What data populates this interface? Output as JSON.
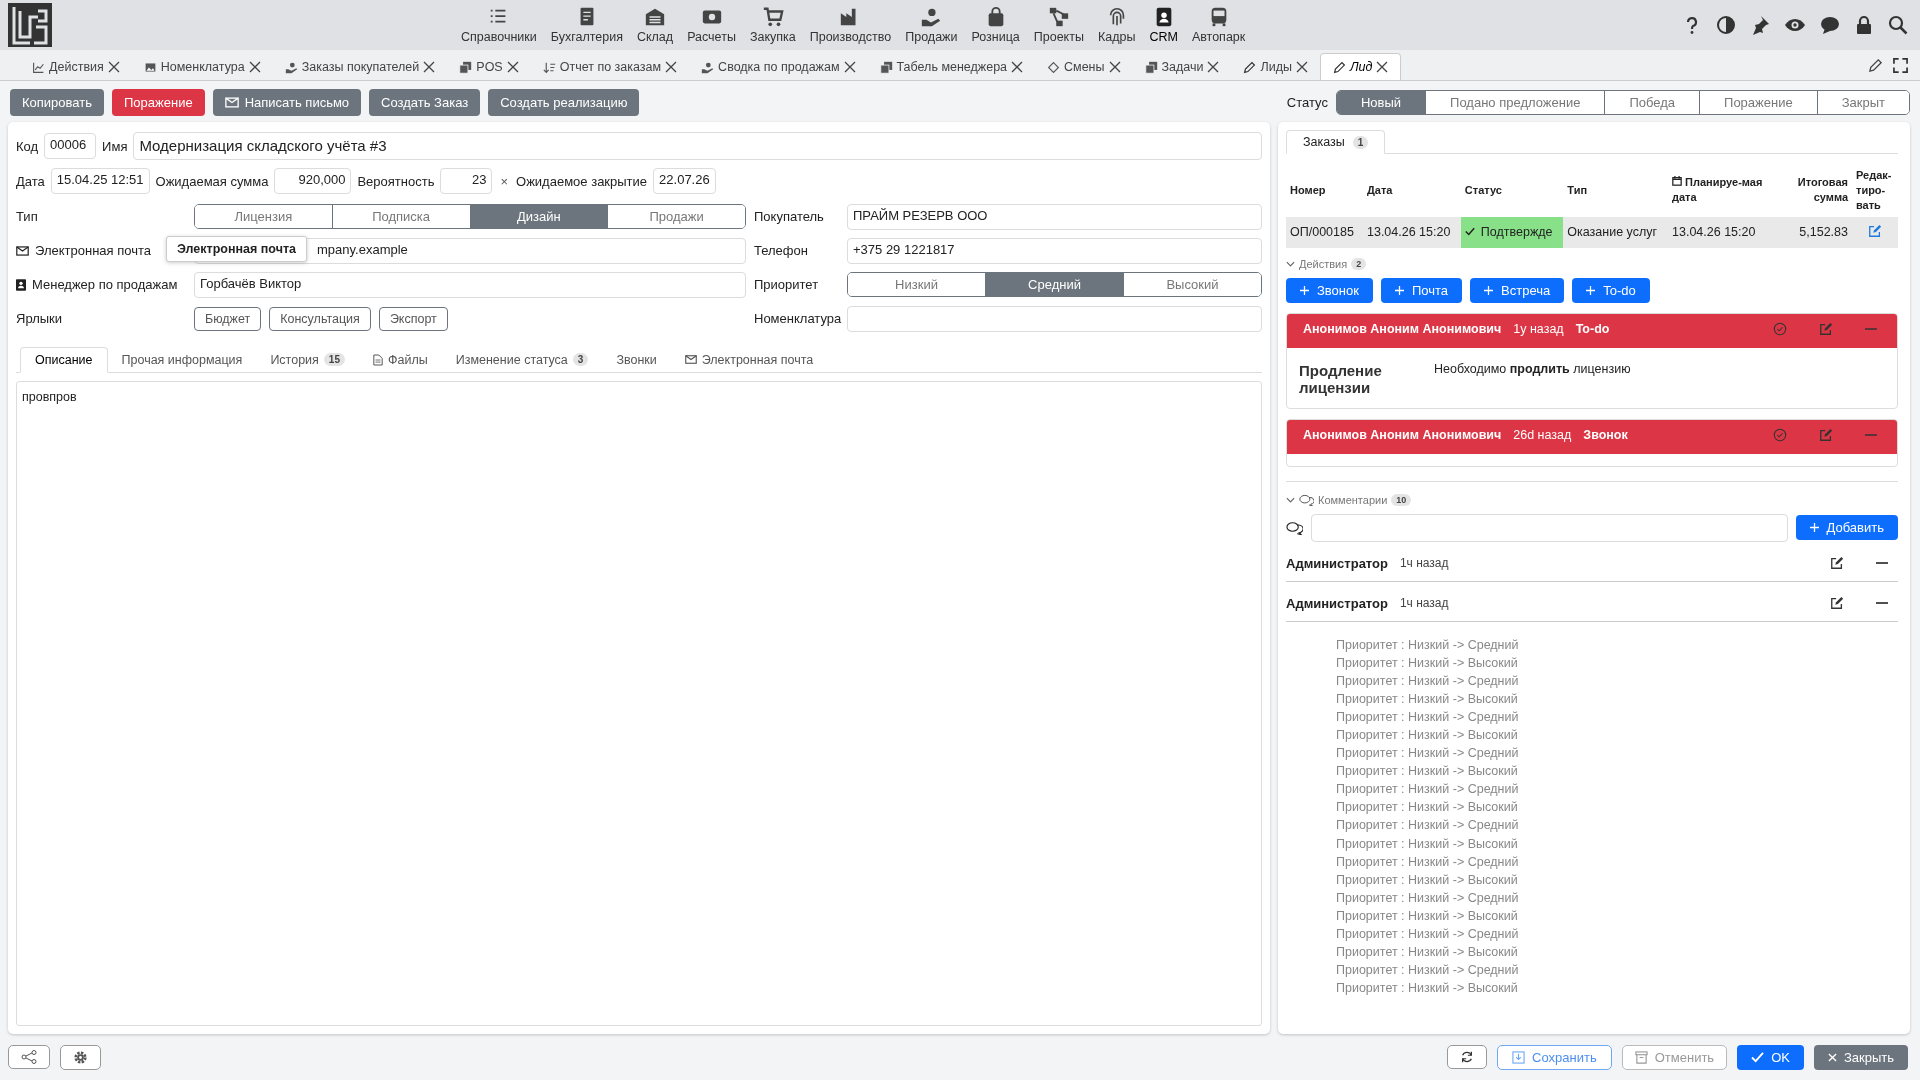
{
  "nav": {
    "menu": [
      {
        "label": "Справочники",
        "selected": false
      },
      {
        "label": "Бухгалтерия",
        "selected": false
      },
      {
        "label": "Склад",
        "selected": false
      },
      {
        "label": "Расчеты",
        "selected": false
      },
      {
        "label": "Закупка",
        "selected": false
      },
      {
        "label": "Производство",
        "selected": false
      },
      {
        "label": "Продажи",
        "selected": false
      },
      {
        "label": "Розница",
        "selected": false
      },
      {
        "label": "Проекты",
        "selected": false
      },
      {
        "label": "Кадры",
        "selected": false
      },
      {
        "label": "CRM",
        "selected": true
      },
      {
        "label": "Автопарк",
        "selected": false
      }
    ]
  },
  "doc_tabs": [
    {
      "label": "Действия",
      "selected": false
    },
    {
      "label": "Номенклатура",
      "selected": false
    },
    {
      "label": "Заказы покупателей",
      "selected": false
    },
    {
      "label": "POS",
      "selected": false
    },
    {
      "label": "Отчет по заказам",
      "selected": false
    },
    {
      "label": "Сводка по продажам",
      "selected": false
    },
    {
      "label": "Табель менеджера",
      "selected": false
    },
    {
      "label": "Смены",
      "selected": false
    },
    {
      "label": "Задачи",
      "selected": false
    },
    {
      "label": "Лиды",
      "selected": false
    },
    {
      "label": "Лид",
      "selected": true
    }
  ],
  "toolbar": {
    "buttons": [
      {
        "label": "Копировать",
        "kind": "plain"
      },
      {
        "label": "Поражение",
        "kind": "danger"
      },
      {
        "label": "Написать письмо",
        "kind": "mail"
      },
      {
        "label": "Создать Заказ",
        "kind": "plain"
      },
      {
        "label": "Создать реализацию",
        "kind": "plain"
      }
    ]
  },
  "status": {
    "label": "Статус",
    "options": [
      {
        "label": "Новый",
        "selected": true
      },
      {
        "label": "Подано предложение",
        "selected": false
      },
      {
        "label": "Победа",
        "selected": false
      },
      {
        "label": "Поражение",
        "selected": false
      },
      {
        "label": "Закрыт",
        "selected": false
      }
    ]
  },
  "form": {
    "code_label": "Код",
    "code": "00006",
    "name_label": "Имя",
    "name": "Модернизация складского учёта #3",
    "date_label": "Дата",
    "date": "15.04.25 12:51",
    "sum_label": "Ожидаемая сумма",
    "sum": "920,000",
    "prob_label": "Вероятность",
    "prob": "23",
    "clear": "×",
    "close_label": "Ожидаемое закрытие",
    "close_date": "22.07.26",
    "type_label": "Тип",
    "type_options": [
      {
        "label": "Лицензия",
        "selected": false
      },
      {
        "label": "Подписка",
        "selected": false
      },
      {
        "label": "Дизайн",
        "selected": true
      },
      {
        "label": "Продажи",
        "selected": false
      }
    ],
    "buyer_label": "Покупатель",
    "buyer": "ПРАЙМ РЕЗЕРВ ООО",
    "email_label": "Электронная почта",
    "email_value": "mpany.example",
    "email_tooltip": "Электронная почта",
    "phone_label": "Телефон",
    "phone": "+375 29 1221817",
    "manager_label": "Менеджер по продажам",
    "manager": "Горбачёв Виктор",
    "priority_label": "Приоритет",
    "priority_options": [
      {
        "label": "Низкий",
        "selected": false
      },
      {
        "label": "Средний",
        "selected": true
      },
      {
        "label": "Высокий",
        "selected": false
      }
    ],
    "tags_label": "Ярлыки",
    "tags": [
      "Бюджет",
      "Консультация",
      "Экспорт"
    ],
    "nomenclature_label": "Номенклатура"
  },
  "detail_tabs": [
    {
      "label": "Описание",
      "kind": "plain",
      "selected": true
    },
    {
      "label": "Прочая информация",
      "kind": "plain",
      "selected": false
    },
    {
      "label": "История",
      "count": "15",
      "kind": "plain",
      "selected": false
    },
    {
      "label": "Файлы",
      "kind": "file",
      "selected": false
    },
    {
      "label": "Изменение статуса",
      "count": "3",
      "kind": "plain",
      "selected": false
    },
    {
      "label": "Звонки",
      "kind": "plain",
      "selected": false
    },
    {
      "label": "Электронная почта",
      "kind": "mail",
      "selected": false
    }
  ],
  "description": "провпров",
  "orders": {
    "tab_label": "Заказы",
    "tab_count": "1",
    "columns": [
      "Номер",
      "Дата",
      "Статус",
      "Тип",
      "Планируе-мая дата",
      "Итоговая сумма",
      "Редак-тиро-вать"
    ],
    "rows": [
      {
        "number": "ОП/000185",
        "date": "13.04.26 15:20",
        "status": "Подтвержде",
        "type": "Оказание услуг",
        "planned": "13.04.26 15:20",
        "total": "5,152.83"
      }
    ]
  },
  "actions": {
    "label": "Действия",
    "count": "2",
    "buttons": [
      "Звонок",
      "Почта",
      "Встреча",
      "To-do"
    ],
    "cards": [
      {
        "author": "Анонимов Аноним Анонимович",
        "ago": "1y назад",
        "type": "To-do",
        "title": "Продление лицензии",
        "text": "Необходимо **продлить** лицензию"
      },
      {
        "author": "Анонимов Аноним Анонимович",
        "ago": "26d назад",
        "type": "Звонок"
      }
    ]
  },
  "comments": {
    "label": "Комментарии",
    "count": "10",
    "add_button": "Добавить",
    "items": [
      {
        "author": "Администратор",
        "ago": "1ч назад"
      },
      {
        "author": "Администратор",
        "ago": "1ч назад",
        "lines": [
          "Приоритет : Низкий -> Средний",
          "Приоритет : Низкий -> Высокий",
          "Приоритет : Низкий -> Средний",
          "Приоритет : Низкий -> Высокий",
          "Приоритет : Низкий -> Средний",
          "Приоритет : Низкий -> Высокий",
          "Приоритет : Низкий -> Средний",
          "Приоритет : Низкий -> Высокий",
          "Приоритет : Низкий -> Средний",
          "Приоритет : Низкий -> Высокий",
          "Приоритет : Низкий -> Средний",
          "Приоритет : Низкий -> Высокий",
          "Приоритет : Низкий -> Средний",
          "Приоритет : Низкий -> Высокий",
          "Приоритет : Низкий -> Средний",
          "Приоритет : Низкий -> Высокий",
          "Приоритет : Низкий -> Средний",
          "Приоритет : Низкий -> Высокий",
          "Приоритет : Низкий -> Средний",
          "Приоритет : Низкий -> Высокий"
        ]
      }
    ]
  },
  "footer": {
    "save": "Сохранить",
    "cancel": "Отменить",
    "ok": "OK",
    "close": "Закрыть"
  }
}
